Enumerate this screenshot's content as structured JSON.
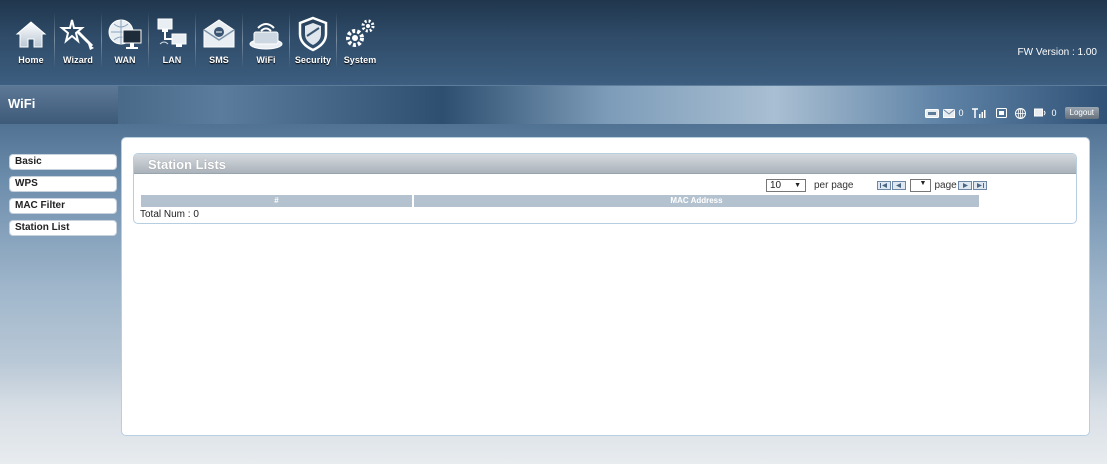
{
  "nav": {
    "items": [
      {
        "label": "Home",
        "icon": "home-icon"
      },
      {
        "label": "Wizard",
        "icon": "wizard-icon"
      },
      {
        "label": "WAN",
        "icon": "wan-icon"
      },
      {
        "label": "LAN",
        "icon": "lan-icon"
      },
      {
        "label": "SMS",
        "icon": "sms-icon"
      },
      {
        "label": "WiFi",
        "icon": "wifi-icon"
      },
      {
        "label": "Security",
        "icon": "security-icon"
      },
      {
        "label": "System",
        "icon": "system-icon"
      }
    ],
    "fw_version": "FW Version : 1.00"
  },
  "section": {
    "title": "WiFi"
  },
  "status": {
    "sms_count": "0",
    "wifi_clients": "0",
    "logout_label": "Logout"
  },
  "sidebar": {
    "items": [
      {
        "label": "Basic"
      },
      {
        "label": "WPS"
      },
      {
        "label": "MAC Filter"
      },
      {
        "label": "Station List"
      }
    ]
  },
  "panel": {
    "title": "Station Lists",
    "pager": {
      "per_page_value": "10",
      "per_page_label": "per page",
      "page_label": "page"
    },
    "table": {
      "columns": [
        "#",
        "MAC Address"
      ]
    },
    "total": "Total Num : 0"
  },
  "colors": {
    "header_dark": "#20364d",
    "accent_blue": "#3d5e80",
    "table_header": "#b4c2cf",
    "panel_border": "#b7cde0"
  }
}
